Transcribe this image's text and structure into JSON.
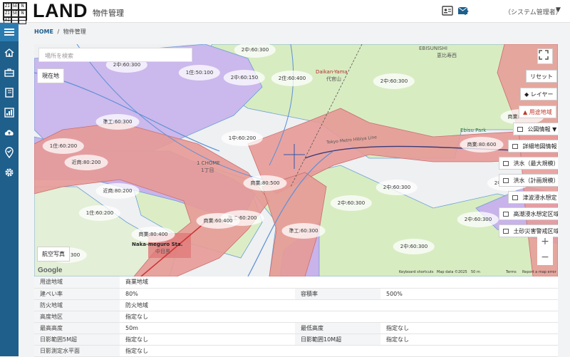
{
  "app": {
    "logo_cells": [
      "ZI",
      "SE",
      "N",
      "ZI",
      "SE",
      "N",
      "AI",
      "",
      ""
    ],
    "logo_word": "LAND",
    "title": "物件管理"
  },
  "user": {
    "name": "（システム管理者）"
  },
  "breadcrumb": {
    "home": "HOME",
    "separator": "/",
    "current": "物件管理"
  },
  "map": {
    "search_placeholder": "場所を検索",
    "current_location": "現在地",
    "aerial_photo": "航空写真",
    "reset": "リセット",
    "layer": "レイヤー",
    "zoning": "用途地域",
    "public_map_info": "公図情報 ▼",
    "detail_map_info": "詳細地図情報",
    "flood_max": "洪水（最大規模）",
    "flood_plan": "洪水（計画規模）",
    "tsunami": "津波浸水想定",
    "storm_surge": "高潮浸水想定区域",
    "landslide": "土砂災害警戒区域",
    "zoom_in": "+",
    "zoom_out": "−",
    "google": "Google",
    "shortcuts": "Keyboard shortcuts",
    "map_data": "Map data ©2025",
    "scale": "50 m",
    "terms": "Terms",
    "report": "Report a map error",
    "area_names": {
      "ebisunishi": "EBISUNISHI",
      "ebisunishi_jp": "恵比寿西",
      "daikanyama": "Daikan-Yama",
      "daikanyama_jp": "代官山",
      "ebisu_park": "Ebisu Park",
      "nakameguro": "Naka-meguro Sta.",
      "nakameguro_jp": "中目黒",
      "chome1": "1 CHOME",
      "chome1_jp": "1丁目",
      "line": "Tokyo Metro Hibiya Line"
    },
    "zone_labels": [
      "2中:60:300",
      "1住:50:100",
      "2中:60:150",
      "2住:60:400",
      "2中:60:300",
      "準工:60:300",
      "1中:60:200",
      "商業:80:600",
      "1住:60:200",
      "近商:80:200",
      "商業:80:500",
      "近商:80:200",
      "2中:60:300",
      "1住:60:200",
      "準工:60:200",
      "商業:60:400",
      "2中:60:300",
      "商業:80:400",
      "準工:60:300",
      "2中:60:300",
      "2中:60:300",
      "商業:80:500",
      "2中:60:300",
      "2中:60:300",
      "2中:60:300",
      "商業:80:600"
    ]
  },
  "info": {
    "rows": [
      {
        "label": "用途地域",
        "value": "商業地域",
        "label2": "",
        "value2": ""
      },
      {
        "label": "建ぺい率",
        "value": "80%",
        "label2": "容積率",
        "value2": "500%"
      },
      {
        "label": "防火地域",
        "value": "防火地域",
        "label2": "",
        "value2": ""
      },
      {
        "label": "高度地区",
        "value": "指定なし",
        "label2": "",
        "value2": ""
      },
      {
        "label": "最高高度",
        "value": "50m",
        "label2": "最低高度",
        "value2": "指定なし"
      },
      {
        "label": "日影範囲5M超",
        "value": "指定なし",
        "label2": "日影範囲10M超",
        "value2": "指定なし"
      },
      {
        "label": "日影測定水平面",
        "value": "指定なし",
        "label2": "",
        "value2": ""
      }
    ]
  },
  "colors": {
    "sidebar": "#1e5f8c",
    "commercial": "#e8908f",
    "residential_green": "#d7ecc0",
    "residential_purple": "#c9b6ea",
    "accent_red": "#c0392b"
  }
}
